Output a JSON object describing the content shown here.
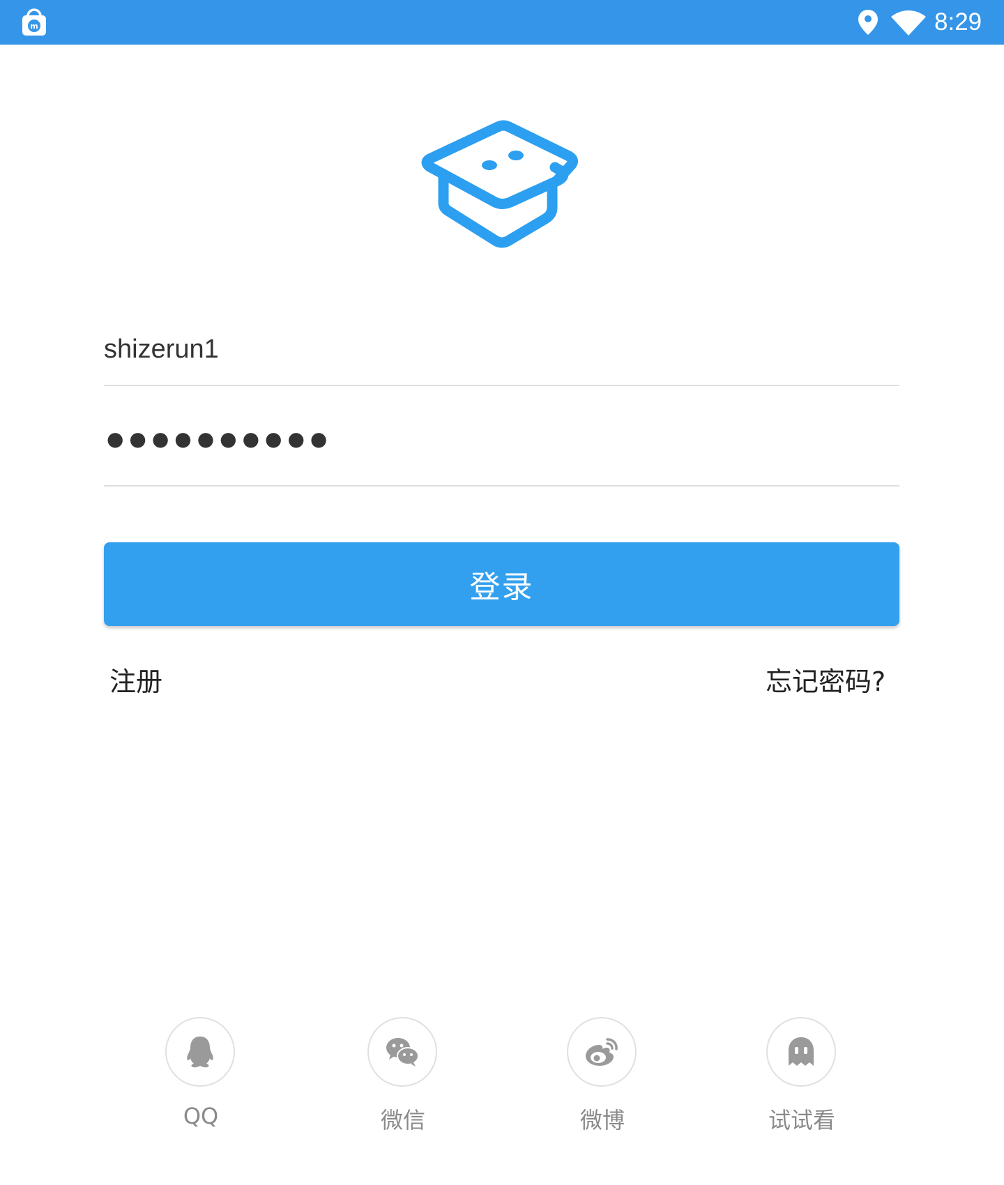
{
  "status_bar": {
    "time": "8:29",
    "icons": [
      "app-store-bag-icon",
      "location-pin-icon",
      "wifi-icon"
    ]
  },
  "logo": {
    "icon": "graduation-cap-logo-icon"
  },
  "login_form": {
    "username": "shizerun1",
    "password_masked": "●●●●●●●●●●",
    "login_label": "登录",
    "register_label": "注册",
    "forgot_label": "忘记密码?"
  },
  "social_login": [
    {
      "label": "QQ",
      "icon": "qq-penguin-icon"
    },
    {
      "label": "微信",
      "icon": "wechat-icon"
    },
    {
      "label": "微博",
      "icon": "weibo-icon"
    },
    {
      "label": "试试看",
      "icon": "ghost-icon"
    }
  ],
  "colors": {
    "status_bar": "#3596e9",
    "primary_button": "#33a0ef",
    "logo": "#2c9ff0",
    "social_icon": "#9a9a9a"
  }
}
